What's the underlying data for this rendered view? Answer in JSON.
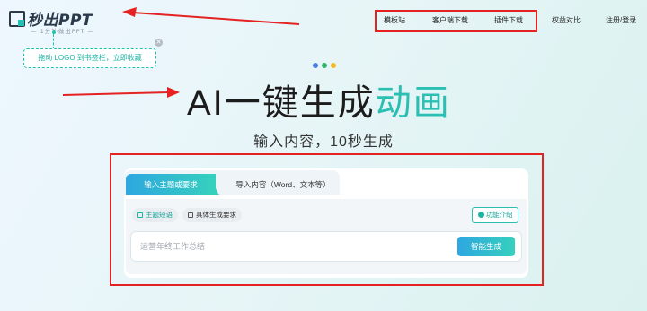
{
  "logo": {
    "text": "秒出PPT",
    "tagline": "— 1分钟做出PPT —"
  },
  "drag_tip": {
    "text": "拖动 LOGO 到书签栏，立即收藏",
    "close_glyph": "✕"
  },
  "nav": {
    "items": [
      "模板站",
      "客户端下载",
      "插件下载",
      "权益对比",
      "注册/登录"
    ]
  },
  "dots": {
    "colors": [
      "#4a7be0",
      "#31b56a",
      "#f2b92b"
    ]
  },
  "hero": {
    "headline_black": "AI一键生成",
    "headline_teal": "动画",
    "subline": "输入内容，10秒生成"
  },
  "card": {
    "tab_active": "输入主题或要求",
    "tab_inactive": "导入内容（Word、文本等）",
    "chips": [
      "主题短语",
      "具体生成要求"
    ],
    "feature_button": "功能介绍",
    "input_placeholder": "运营年终工作总结",
    "generate_button": "智能生成"
  },
  "colors": {
    "accent_teal": "#2bbfb3",
    "annotation_red": "#e52222"
  }
}
